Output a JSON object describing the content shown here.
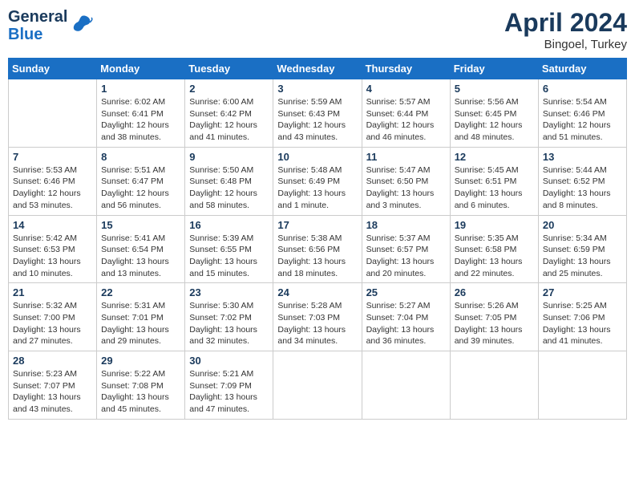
{
  "header": {
    "logo_line1": "General",
    "logo_line2": "Blue",
    "month_year": "April 2024",
    "location": "Bingoel, Turkey"
  },
  "weekdays": [
    "Sunday",
    "Monday",
    "Tuesday",
    "Wednesday",
    "Thursday",
    "Friday",
    "Saturday"
  ],
  "weeks": [
    [
      {
        "day": "",
        "info": ""
      },
      {
        "day": "1",
        "info": "Sunrise: 6:02 AM\nSunset: 6:41 PM\nDaylight: 12 hours\nand 38 minutes."
      },
      {
        "day": "2",
        "info": "Sunrise: 6:00 AM\nSunset: 6:42 PM\nDaylight: 12 hours\nand 41 minutes."
      },
      {
        "day": "3",
        "info": "Sunrise: 5:59 AM\nSunset: 6:43 PM\nDaylight: 12 hours\nand 43 minutes."
      },
      {
        "day": "4",
        "info": "Sunrise: 5:57 AM\nSunset: 6:44 PM\nDaylight: 12 hours\nand 46 minutes."
      },
      {
        "day": "5",
        "info": "Sunrise: 5:56 AM\nSunset: 6:45 PM\nDaylight: 12 hours\nand 48 minutes."
      },
      {
        "day": "6",
        "info": "Sunrise: 5:54 AM\nSunset: 6:46 PM\nDaylight: 12 hours\nand 51 minutes."
      }
    ],
    [
      {
        "day": "7",
        "info": "Sunrise: 5:53 AM\nSunset: 6:46 PM\nDaylight: 12 hours\nand 53 minutes."
      },
      {
        "day": "8",
        "info": "Sunrise: 5:51 AM\nSunset: 6:47 PM\nDaylight: 12 hours\nand 56 minutes."
      },
      {
        "day": "9",
        "info": "Sunrise: 5:50 AM\nSunset: 6:48 PM\nDaylight: 12 hours\nand 58 minutes."
      },
      {
        "day": "10",
        "info": "Sunrise: 5:48 AM\nSunset: 6:49 PM\nDaylight: 13 hours\nand 1 minute."
      },
      {
        "day": "11",
        "info": "Sunrise: 5:47 AM\nSunset: 6:50 PM\nDaylight: 13 hours\nand 3 minutes."
      },
      {
        "day": "12",
        "info": "Sunrise: 5:45 AM\nSunset: 6:51 PM\nDaylight: 13 hours\nand 6 minutes."
      },
      {
        "day": "13",
        "info": "Sunrise: 5:44 AM\nSunset: 6:52 PM\nDaylight: 13 hours\nand 8 minutes."
      }
    ],
    [
      {
        "day": "14",
        "info": "Sunrise: 5:42 AM\nSunset: 6:53 PM\nDaylight: 13 hours\nand 10 minutes."
      },
      {
        "day": "15",
        "info": "Sunrise: 5:41 AM\nSunset: 6:54 PM\nDaylight: 13 hours\nand 13 minutes."
      },
      {
        "day": "16",
        "info": "Sunrise: 5:39 AM\nSunset: 6:55 PM\nDaylight: 13 hours\nand 15 minutes."
      },
      {
        "day": "17",
        "info": "Sunrise: 5:38 AM\nSunset: 6:56 PM\nDaylight: 13 hours\nand 18 minutes."
      },
      {
        "day": "18",
        "info": "Sunrise: 5:37 AM\nSunset: 6:57 PM\nDaylight: 13 hours\nand 20 minutes."
      },
      {
        "day": "19",
        "info": "Sunrise: 5:35 AM\nSunset: 6:58 PM\nDaylight: 13 hours\nand 22 minutes."
      },
      {
        "day": "20",
        "info": "Sunrise: 5:34 AM\nSunset: 6:59 PM\nDaylight: 13 hours\nand 25 minutes."
      }
    ],
    [
      {
        "day": "21",
        "info": "Sunrise: 5:32 AM\nSunset: 7:00 PM\nDaylight: 13 hours\nand 27 minutes."
      },
      {
        "day": "22",
        "info": "Sunrise: 5:31 AM\nSunset: 7:01 PM\nDaylight: 13 hours\nand 29 minutes."
      },
      {
        "day": "23",
        "info": "Sunrise: 5:30 AM\nSunset: 7:02 PM\nDaylight: 13 hours\nand 32 minutes."
      },
      {
        "day": "24",
        "info": "Sunrise: 5:28 AM\nSunset: 7:03 PM\nDaylight: 13 hours\nand 34 minutes."
      },
      {
        "day": "25",
        "info": "Sunrise: 5:27 AM\nSunset: 7:04 PM\nDaylight: 13 hours\nand 36 minutes."
      },
      {
        "day": "26",
        "info": "Sunrise: 5:26 AM\nSunset: 7:05 PM\nDaylight: 13 hours\nand 39 minutes."
      },
      {
        "day": "27",
        "info": "Sunrise: 5:25 AM\nSunset: 7:06 PM\nDaylight: 13 hours\nand 41 minutes."
      }
    ],
    [
      {
        "day": "28",
        "info": "Sunrise: 5:23 AM\nSunset: 7:07 PM\nDaylight: 13 hours\nand 43 minutes."
      },
      {
        "day": "29",
        "info": "Sunrise: 5:22 AM\nSunset: 7:08 PM\nDaylight: 13 hours\nand 45 minutes."
      },
      {
        "day": "30",
        "info": "Sunrise: 5:21 AM\nSunset: 7:09 PM\nDaylight: 13 hours\nand 47 minutes."
      },
      {
        "day": "",
        "info": ""
      },
      {
        "day": "",
        "info": ""
      },
      {
        "day": "",
        "info": ""
      },
      {
        "day": "",
        "info": ""
      }
    ]
  ]
}
